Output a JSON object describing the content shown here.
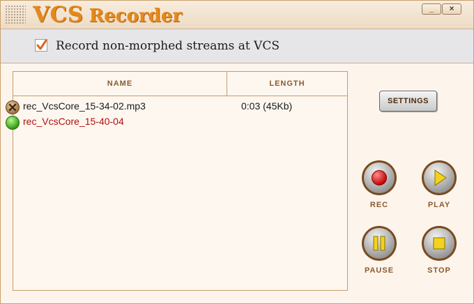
{
  "window": {
    "title_part1": "VCS",
    "title_part2": "Recorder",
    "minimize_label": "_",
    "close_label": "×"
  },
  "options": {
    "record_non_morphed_label": "Record non-morphed streams at VCS",
    "record_non_morphed_checked": true
  },
  "file_list": {
    "columns": [
      "NAME",
      "LENGTH"
    ],
    "rows": [
      {
        "name": "rec_VcsCore_15-34-02.mp3",
        "length": "0:03 (45Kb)",
        "status": "stopped",
        "status_icon": "x-circle-icon"
      },
      {
        "name": "rec_VcsCore_15-40-04",
        "length": "",
        "status": "recording",
        "status_icon": "green-dot-icon"
      }
    ]
  },
  "controls": {
    "settings_label": "SETTINGS",
    "rec_label": "REC",
    "play_label": "PLAY",
    "pause_label": "PAUSE",
    "stop_label": "STOP"
  },
  "icons": {
    "rec": "record-dot-icon",
    "play": "play-triangle-icon",
    "pause": "pause-bars-icon",
    "stop": "stop-square-icon"
  },
  "colors": {
    "title_orange": "#e5891c",
    "accent_brown": "#8a5a2e",
    "recording_red": "#b20e0e",
    "check_orange": "#e2631a",
    "control_yellow": "#f2d21c",
    "record_red": "#e01010"
  }
}
